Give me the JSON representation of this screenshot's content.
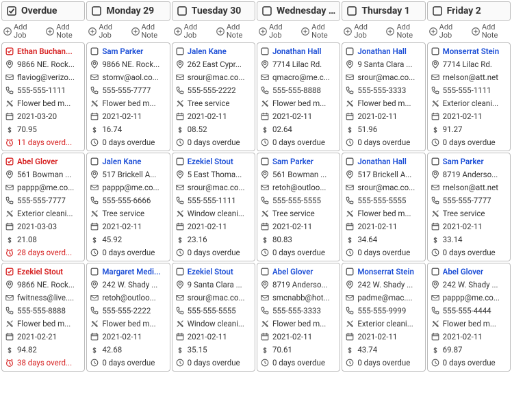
{
  "addJobLabel": "Add Job",
  "addNoteLabel": "Add Note",
  "columns": [
    {
      "title": "Overdue",
      "checked": true,
      "cards": [
        {
          "name": "Ethan Buchan...",
          "address": "9866 NE. Rock...",
          "email": "flaviog@verizo...",
          "phone": "555-555-1111",
          "service": "Flower bed m...",
          "date": "2021-03-20",
          "amount": "70.95",
          "due": "11 days overd...",
          "overdue": true
        },
        {
          "name": "Abel Glover",
          "address": "561 Bowman ...",
          "email": "pappp@me.co...",
          "phone": "555-555-7777",
          "service": "Exterior cleani...",
          "date": "2021-03-03",
          "amount": "21.08",
          "due": "28 days overd...",
          "overdue": true
        },
        {
          "name": "Ezekiel Stout",
          "address": "9866 NE. Rock...",
          "email": "fwitness@live....",
          "phone": "555-555-8888",
          "service": "Flower bed m...",
          "date": "2021-02-21",
          "amount": "94.82",
          "due": "38 days overd...",
          "overdue": true
        }
      ]
    },
    {
      "title": "Monday 29",
      "checked": false,
      "cards": [
        {
          "name": "Sam Parker",
          "address": "9866 NE. Rock...",
          "email": "stomv@aol.co...",
          "phone": "555-555-7777",
          "service": "Flower bed m...",
          "date": "2021-02-11",
          "amount": "16.74",
          "due": "0 days overdue",
          "overdue": false
        },
        {
          "name": "Jalen Kane",
          "address": "517 Brickell A...",
          "email": "pappp@me.co...",
          "phone": "555-555-6666",
          "service": "Tree service",
          "date": "2021-02-11",
          "amount": "45.92",
          "due": "0 days overdue",
          "overdue": false
        },
        {
          "name": "Margaret Medi...",
          "address": "242 W. Shady ...",
          "email": "retoh@outloo...",
          "phone": "555-555-2222",
          "service": "Flower bed m...",
          "date": "2021-02-11",
          "amount": "42.68",
          "due": "0 days overdue",
          "overdue": false
        }
      ]
    },
    {
      "title": "Tuesday 30",
      "checked": false,
      "cards": [
        {
          "name": "Jalen Kane",
          "address": "262 East Cypr...",
          "email": "srour@mac.co...",
          "phone": "555-555-2222",
          "service": "Tree service",
          "date": "2021-02-11",
          "amount": "08.52",
          "due": "0 days overdue",
          "overdue": false
        },
        {
          "name": "Ezekiel Stout",
          "address": "5 East Thoma...",
          "email": "srour@mac.co...",
          "phone": "555-555-1111",
          "service": "Window cleani...",
          "date": "2021-02-11",
          "amount": "23.16",
          "due": "0 days overdue",
          "overdue": false
        },
        {
          "name": "Ezekiel Stout",
          "address": "9 Santa Clara ...",
          "email": "srour@mac.co...",
          "phone": "555-555-5555",
          "service": "Window cleani...",
          "date": "2021-02-11",
          "amount": "35.15",
          "due": "0 days overdue",
          "overdue": false
        }
      ]
    },
    {
      "title": "Wednesday ...",
      "checked": false,
      "cards": [
        {
          "name": "Jonathan Hall",
          "address": "7714 Lilac Rd.",
          "email": "qmacro@me.c...",
          "phone": "555-555-8888",
          "service": "Flower bed m...",
          "date": "2021-02-11",
          "amount": "02.64",
          "due": "0 days overdue",
          "overdue": false
        },
        {
          "name": "Sam Parker",
          "address": "561 Bowman ...",
          "email": "retoh@outloo...",
          "phone": "555-555-5555",
          "service": "Tree service",
          "date": "2021-02-11",
          "amount": "80.83",
          "due": "0 days overdue",
          "overdue": false
        },
        {
          "name": "Abel Glover",
          "address": "8719 Anderso...",
          "email": "smcnabb@hot...",
          "phone": "555-555-3333",
          "service": "Flower bed m...",
          "date": "2021-02-11",
          "amount": "70.61",
          "due": "0 days overdue",
          "overdue": false
        }
      ]
    },
    {
      "title": "Thursday 1",
      "checked": false,
      "cards": [
        {
          "name": "Jonathan Hall",
          "address": "9 Santa Clara ...",
          "email": "srour@mac.co...",
          "phone": "555-555-3333",
          "service": "Flower bed m...",
          "date": "2021-02-11",
          "amount": "51.96",
          "due": "0 days overdue",
          "overdue": false
        },
        {
          "name": "Jonathan Hall",
          "address": "517 Brickell A...",
          "email": "srour@mac.co...",
          "phone": "555-555-5555",
          "service": "Flower bed m...",
          "date": "2021-02-11",
          "amount": "34.64",
          "due": "0 days overdue",
          "overdue": false
        },
        {
          "name": "Monserrat Stein",
          "address": "242 W. Shady ...",
          "email": "padme@mac....",
          "phone": "555-555-9999",
          "service": "Exterior cleani...",
          "date": "2021-02-11",
          "amount": "43.74",
          "due": "0 days overdue",
          "overdue": false
        }
      ]
    },
    {
      "title": "Friday 2",
      "checked": false,
      "cards": [
        {
          "name": "Monserrat Stein",
          "address": "7714 Lilac Rd.",
          "email": "rnelson@att.net",
          "phone": "555-555-1111",
          "service": "Exterior cleani...",
          "date": "2021-02-11",
          "amount": "91.27",
          "due": "0 days overdue",
          "overdue": false
        },
        {
          "name": "Sam Parker",
          "address": "8719 Anderso...",
          "email": "rnelson@att.net",
          "phone": "555-555-7777",
          "service": "Tree service",
          "date": "2021-02-11",
          "amount": "33.14",
          "due": "0 days overdue",
          "overdue": false
        },
        {
          "name": "Abel Glover",
          "address": "242 W. Shady ...",
          "email": "pappp@me.co...",
          "phone": "555-555-4444",
          "service": "Flower bed m...",
          "date": "2021-02-11",
          "amount": "69.87",
          "due": "0 days overdue",
          "overdue": false
        }
      ]
    }
  ]
}
